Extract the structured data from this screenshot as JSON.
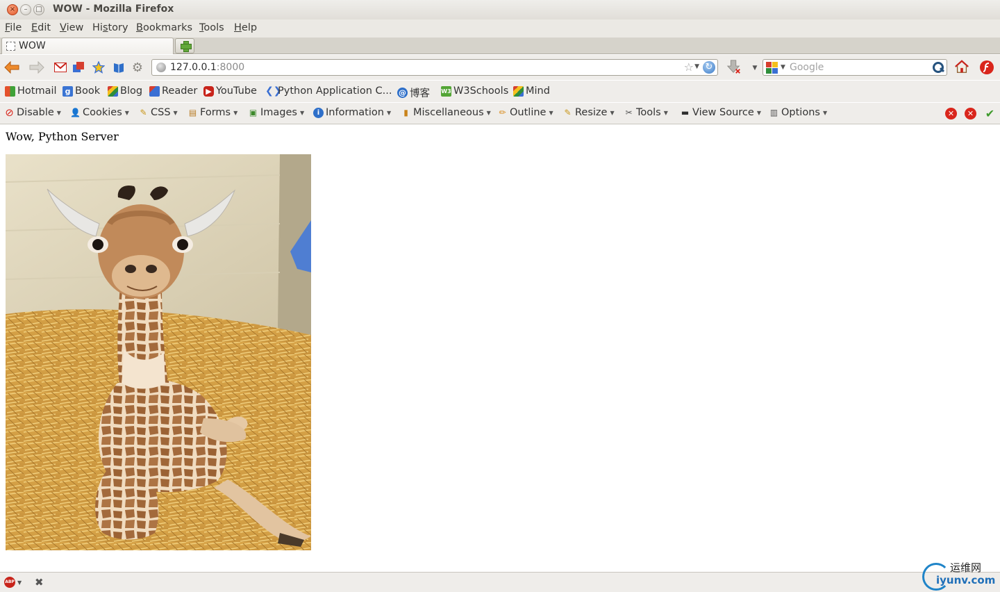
{
  "window": {
    "title": "WOW - Mozilla Firefox",
    "controls": {
      "close": "×",
      "minimize": "–",
      "maximize": "□"
    }
  },
  "menu": [
    {
      "accel": "F",
      "rest": "ile"
    },
    {
      "accel": "E",
      "rest": "dit"
    },
    {
      "accel": "V",
      "rest": "iew"
    },
    {
      "accel": "",
      "pre": "Hi",
      "accel2": "s",
      "rest": "tory"
    },
    {
      "accel": "B",
      "rest": "ookmarks"
    },
    {
      "accel": "T",
      "rest": "ools"
    },
    {
      "accel": "H",
      "rest": "elp"
    }
  ],
  "tab": {
    "label": "WOW"
  },
  "address": {
    "host": "127.0.0.1",
    "port": ":8000"
  },
  "search": {
    "placeholder": "Google"
  },
  "bookmarks": [
    {
      "label": "Hotmail",
      "icon": "windows-icon",
      "color": "#e4512c"
    },
    {
      "label": "Book",
      "icon": "g-book-icon",
      "color": "#3a74d3"
    },
    {
      "label": "Blog",
      "icon": "blogger-icon",
      "color": "#2f8e3b"
    },
    {
      "label": "Reader",
      "icon": "reader-icon",
      "color": "#3a6fd3"
    },
    {
      "label": "YouTube",
      "icon": "youtube-icon",
      "color": "#c8241b"
    },
    {
      "label": "Python Application C...",
      "icon": "google-code-icon",
      "color": "#3a6fd3"
    },
    {
      "label": "博客",
      "icon": "blog-cn-icon",
      "color": "#2e6fc9"
    },
    {
      "label": "W3Schools",
      "icon": "w3schools-icon",
      "color": "#53a535"
    },
    {
      "label": "Mind",
      "icon": "mind-icon",
      "color": "#2f8e3b"
    }
  ],
  "devtools": [
    {
      "label": "Disable",
      "icon": "disable-icon"
    },
    {
      "label": "Cookies",
      "icon": "cookies-icon"
    },
    {
      "label": "CSS",
      "icon": "css-icon"
    },
    {
      "label": "Forms",
      "icon": "forms-icon"
    },
    {
      "label": "Images",
      "icon": "images-icon"
    },
    {
      "label": "Information",
      "icon": "information-icon"
    },
    {
      "label": "Miscellaneous",
      "icon": "miscellaneous-icon"
    },
    {
      "label": "Outline",
      "icon": "outline-icon"
    },
    {
      "label": "Resize",
      "icon": "resize-icon"
    },
    {
      "label": "Tools",
      "icon": "tools-icon"
    },
    {
      "label": "View Source",
      "icon": "view-source-icon"
    },
    {
      "label": "Options",
      "icon": "options-icon"
    }
  ],
  "page": {
    "heading": "Wow, Python Server",
    "image_subject": "baby giraffe lying on straw"
  },
  "statusbar": {
    "abp_label": "ABP"
  },
  "watermark": {
    "cn": "运维网",
    "domain": "iyunv.com"
  },
  "colors": {
    "error": "#d9261c",
    "ok": "#3e9a2c",
    "link_blue": "#1f6fb8"
  }
}
